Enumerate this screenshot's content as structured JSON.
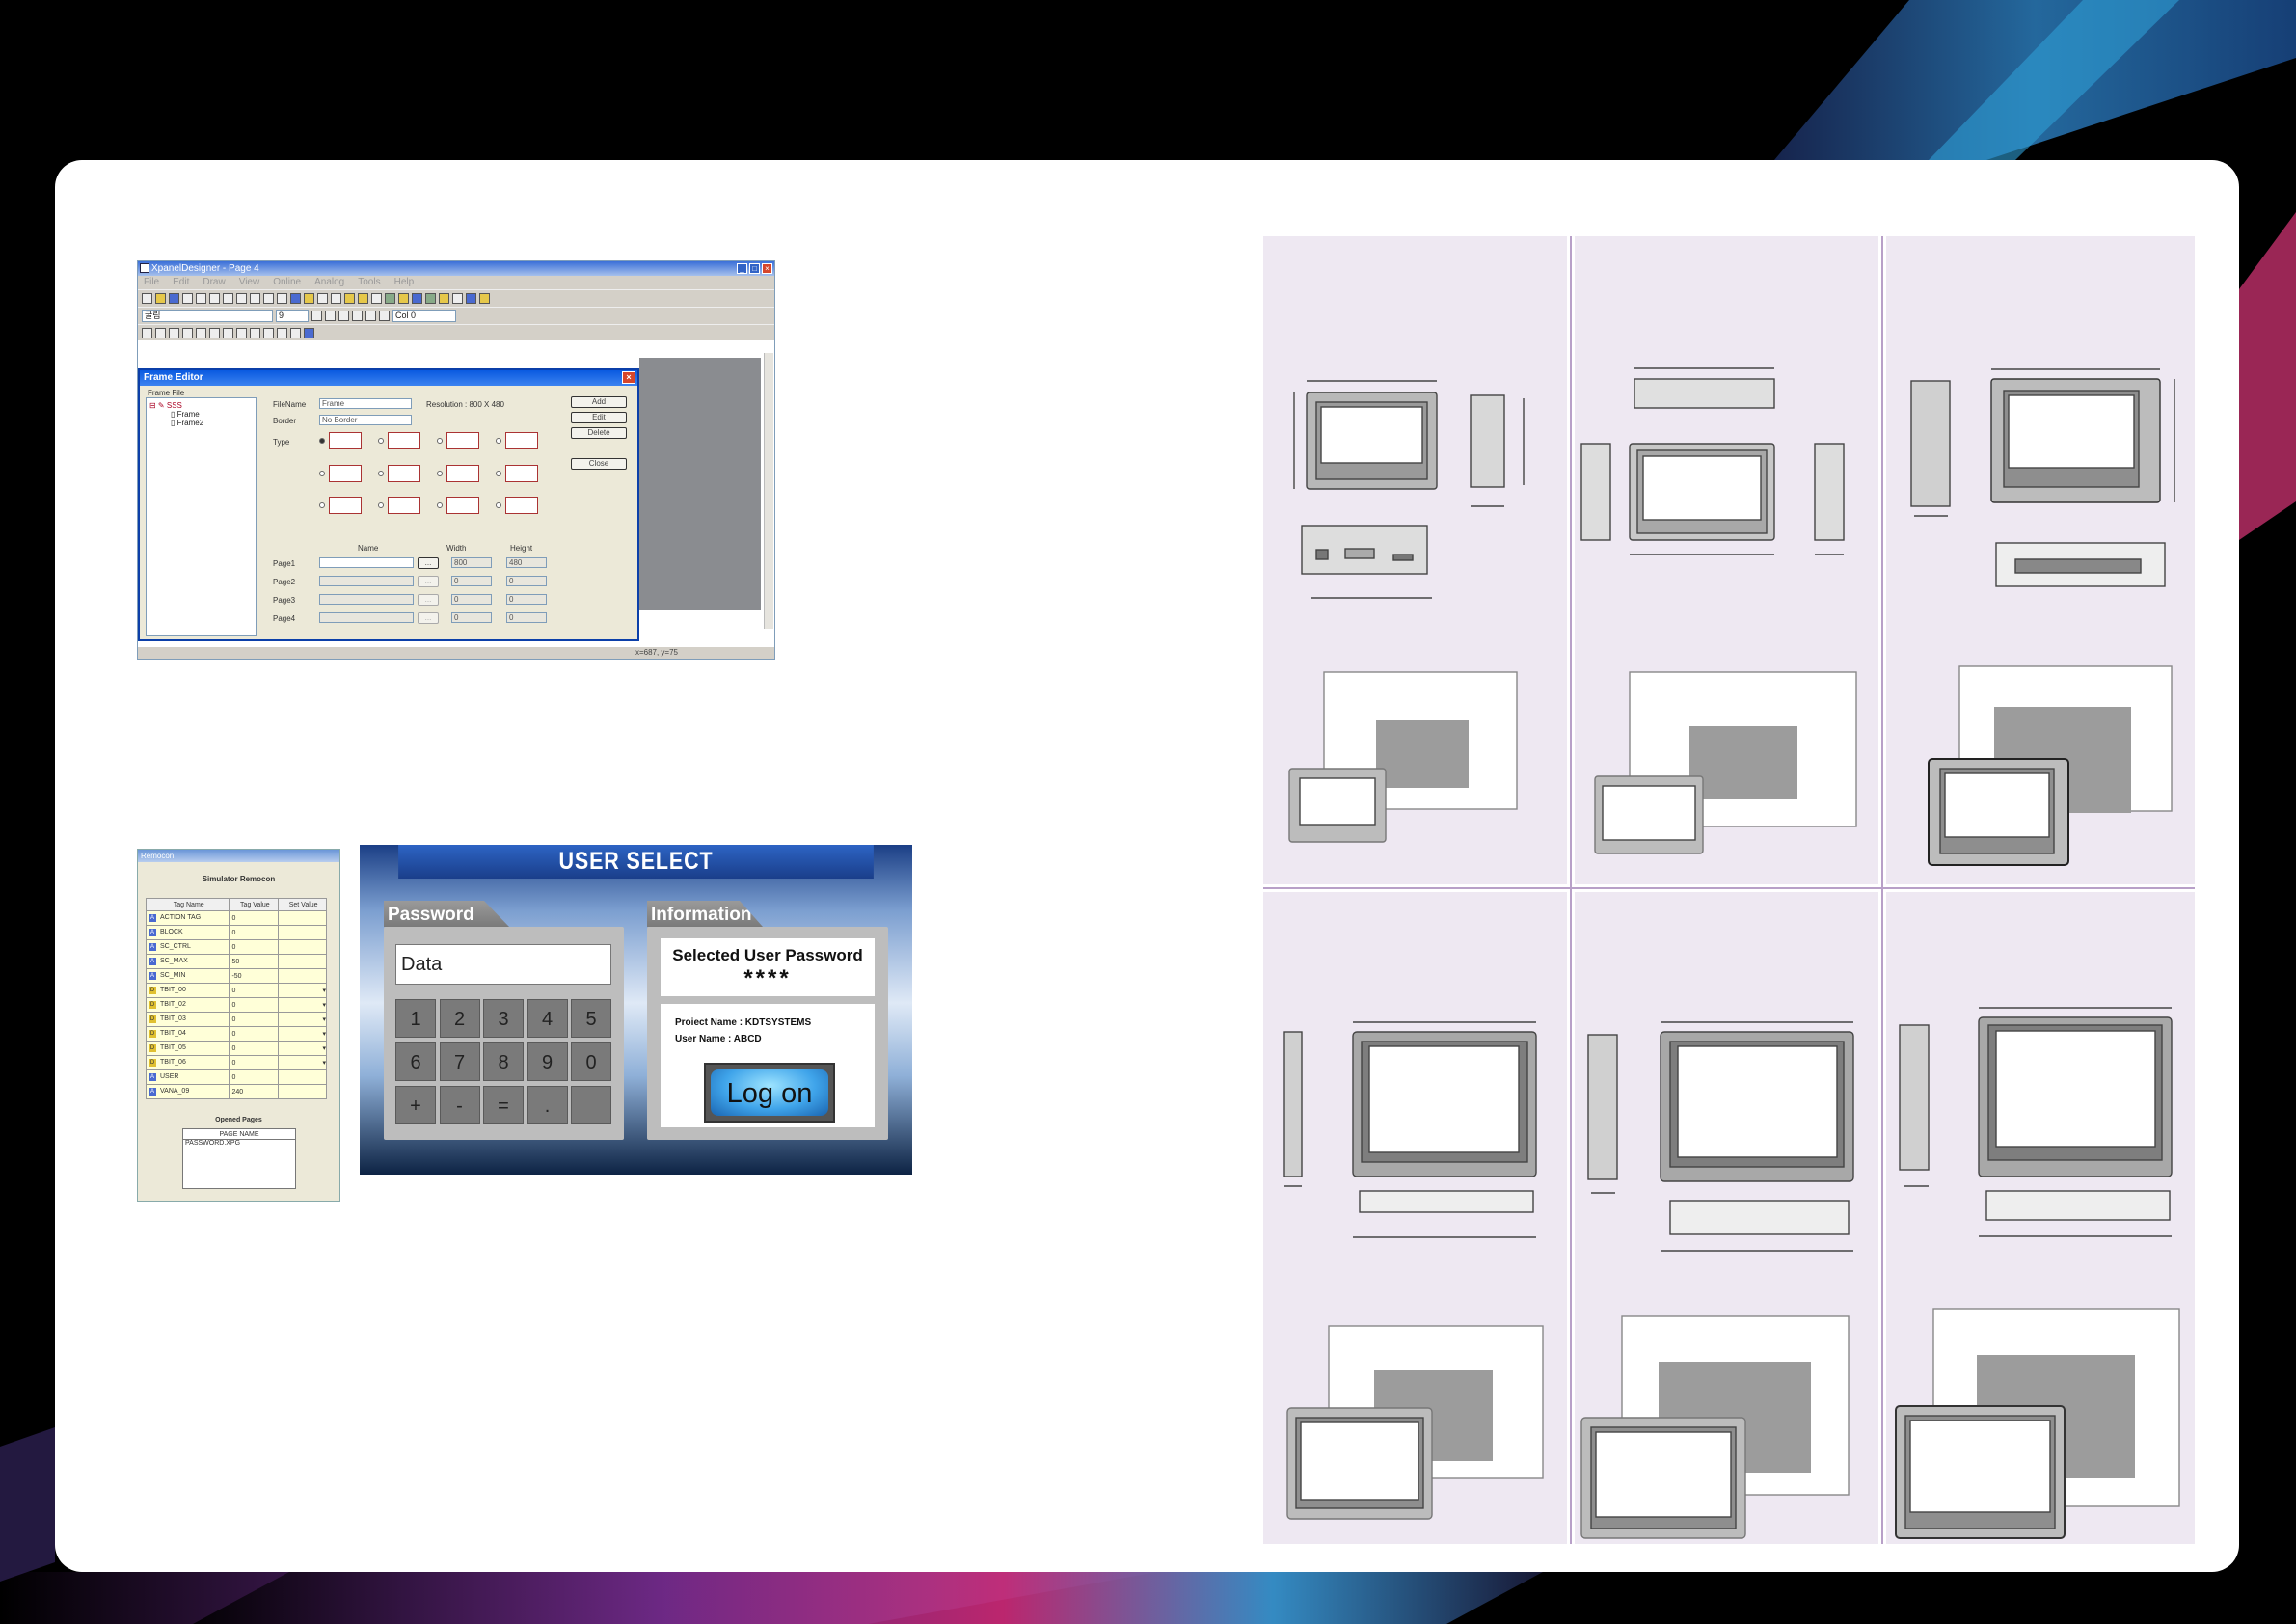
{
  "designer": {
    "title": "XpanelDesigner - Page 4",
    "menu": [
      "File",
      "Edit",
      "Draw",
      "View",
      "Online",
      "Analog",
      "Tools",
      "Help"
    ],
    "font_name": "굴림",
    "font_size": "9",
    "color": "Col 0",
    "status": "x=687, y=75"
  },
  "frame_editor": {
    "title": "Frame Editor",
    "frame_file_label": "Frame File",
    "tree": [
      "SSS",
      "Frame",
      "Frame2"
    ],
    "filename_label": "FileName",
    "filename_value": "Frame",
    "resolution": "Resolution : 800 X 480",
    "border_label": "Border",
    "border_value": "No Border",
    "type_label": "Type",
    "buttons": {
      "add": "Add",
      "edit": "Edit",
      "delete": "Delete",
      "close": "Close"
    },
    "col_name": "Name",
    "col_width": "Width",
    "col_height": "Height",
    "pages": [
      {
        "label": "Page1",
        "width": "800",
        "height": "480"
      },
      {
        "label": "Page2",
        "width": "0",
        "height": "0"
      },
      {
        "label": "Page3",
        "width": "0",
        "height": "0"
      },
      {
        "label": "Page4",
        "width": "0",
        "height": "0"
      }
    ]
  },
  "remocon": {
    "title": "Remocon",
    "heading": "Simulator Remocon",
    "col_tag": "Tag Name",
    "col_value": "Tag Value",
    "col_set": "Set Value",
    "rows": [
      {
        "type": "A",
        "name": "ACTION TAG",
        "value": "0"
      },
      {
        "type": "A",
        "name": "BLOCK",
        "value": "0"
      },
      {
        "type": "A",
        "name": "SC_CTRL",
        "value": "0"
      },
      {
        "type": "A",
        "name": "SC_MAX",
        "value": "50"
      },
      {
        "type": "A",
        "name": "SC_MIN",
        "value": "-50"
      },
      {
        "type": "D",
        "name": "TBIT_00",
        "value": "0"
      },
      {
        "type": "D",
        "name": "TBIT_02",
        "value": "0"
      },
      {
        "type": "D",
        "name": "TBIT_03",
        "value": "0"
      },
      {
        "type": "D",
        "name": "TBIT_04",
        "value": "0"
      },
      {
        "type": "D",
        "name": "TBIT_05",
        "value": "0"
      },
      {
        "type": "D",
        "name": "TBIT_06",
        "value": "0"
      },
      {
        "type": "A",
        "name": "USER",
        "value": "0"
      },
      {
        "type": "A",
        "name": "VANA_09",
        "value": "240"
      }
    ],
    "opened_pages_label": "Opened Pages",
    "page_name_header": "PAGE NAME",
    "opened_pages": [
      "PASSWORD.XPG"
    ]
  },
  "user_select": {
    "title": "USER SELECT",
    "password_tab": "Password",
    "information_tab": "Information",
    "password_field": "Data",
    "keys": [
      "1",
      "2",
      "3",
      "4",
      "5",
      "6",
      "7",
      "8",
      "9",
      "0",
      "+",
      "-",
      "=",
      ".",
      ""
    ],
    "selected_label": "Selected User Password",
    "selected_value": "****",
    "project_name": "Proiect Name : KDTSYSTEMS",
    "user_name": "User Name : ABCD",
    "logon_button": "Log on"
  },
  "colors": {
    "panel_bg": "#eee8f2",
    "accent_blue": "#1f4fa8",
    "separator": "#b8a0c8"
  }
}
